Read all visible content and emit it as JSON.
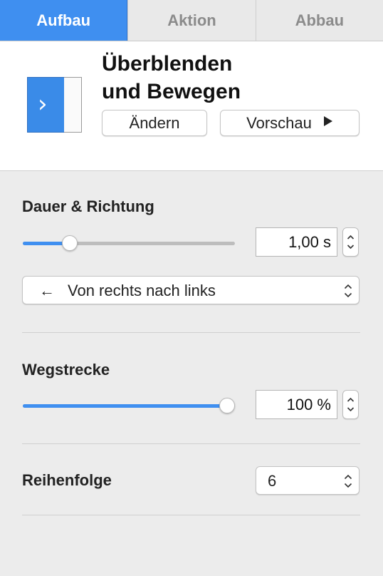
{
  "tabs": [
    {
      "label": "Aufbau",
      "active": true
    },
    {
      "label": "Aktion",
      "active": false
    },
    {
      "label": "Abbau",
      "active": false
    }
  ],
  "effect": {
    "title_line1": "Überblenden",
    "title_line2": "und Bewegen",
    "change_label": "Ändern",
    "preview_label": "Vorschau",
    "preview_icon": "play-icon",
    "thumbnail_icon": "chevron-right-icon"
  },
  "duration": {
    "section_label": "Dauer & Richtung",
    "slider_fraction": 0.2,
    "value": "1,00 s",
    "direction_arrow": "←",
    "direction_label": "Von rechts nach links"
  },
  "distance": {
    "section_label": "Wegstrecke",
    "slider_fraction": 1.0,
    "value": "100 %"
  },
  "order": {
    "section_label": "Reihenfolge",
    "value": "6"
  },
  "colors": {
    "accent": "#3f8ff0",
    "panel_bg": "#ececec"
  }
}
